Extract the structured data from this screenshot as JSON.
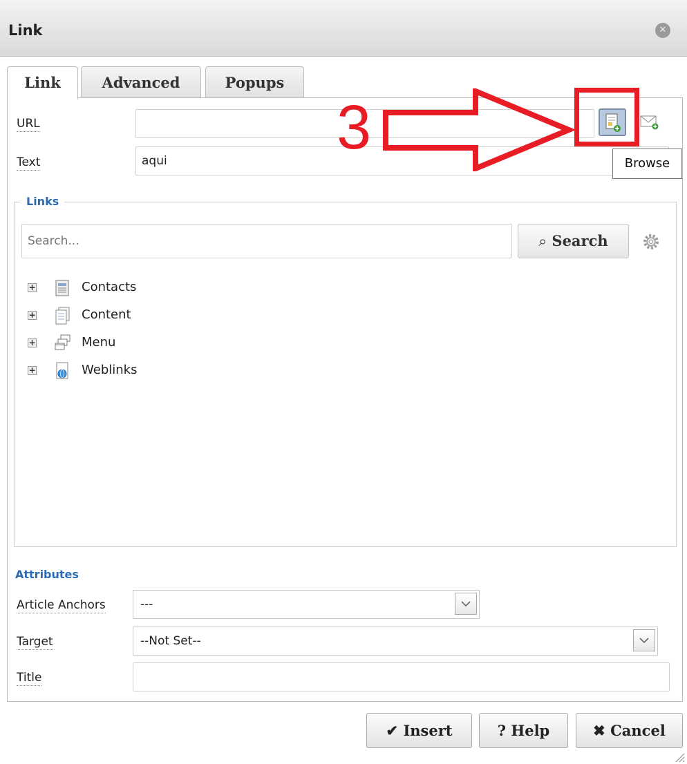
{
  "dialog": {
    "title": "Link"
  },
  "tabs": [
    {
      "label": "Link",
      "active": true
    },
    {
      "label": "Advanced",
      "active": false
    },
    {
      "label": "Popups",
      "active": false
    }
  ],
  "form": {
    "url_label": "URL",
    "url_value": "",
    "text_label": "Text",
    "text_value": "aqui",
    "browse_tooltip": "Browse"
  },
  "annotation": {
    "number": "3",
    "color": "#e81c24"
  },
  "links": {
    "legend": "Links",
    "search_placeholder": "Search...",
    "search_button": "Search",
    "tree": [
      {
        "label": "Contacts",
        "icon": "contacts-icon"
      },
      {
        "label": "Content",
        "icon": "content-icon"
      },
      {
        "label": "Menu",
        "icon": "menu-icon"
      },
      {
        "label": "Weblinks",
        "icon": "weblinks-icon"
      }
    ]
  },
  "attributes": {
    "title": "Attributes",
    "article_anchors_label": "Article Anchors",
    "article_anchors_value": "---",
    "target_label": "Target",
    "target_value": "--Not Set--",
    "title_label": "Title",
    "title_value": ""
  },
  "buttons": {
    "insert": "Insert",
    "help": "Help",
    "cancel": "Cancel"
  },
  "colors": {
    "accent": "#2b6cb0",
    "annotation": "#e81c24"
  }
}
